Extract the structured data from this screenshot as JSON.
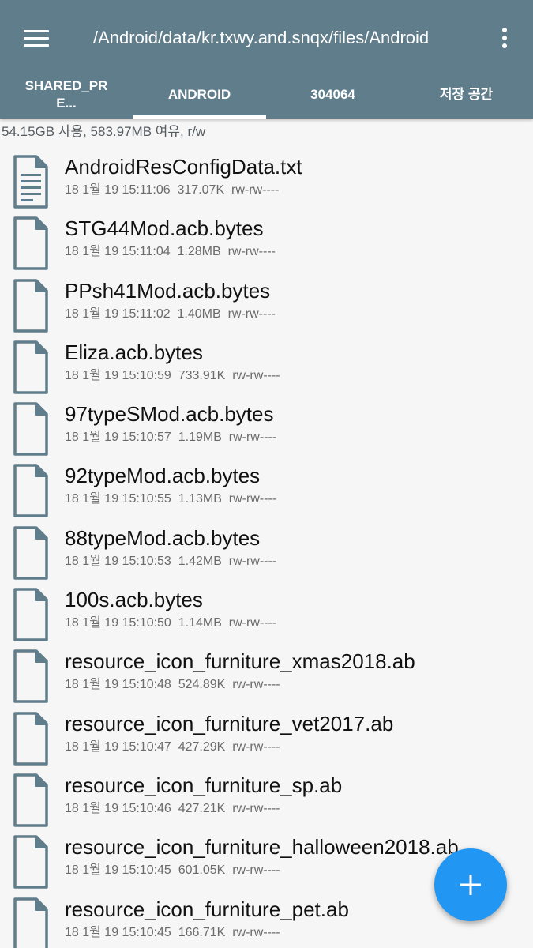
{
  "appbar": {
    "path": "/Android/data/kr.txwy.and.snqx/files/Android",
    "menu_icon": "hamburger-menu-icon",
    "more_icon": "vertical-dots-icon",
    "color": "#607d8b"
  },
  "tabs": [
    {
      "label": "SHARED_PRE..."
    },
    {
      "label": "ANDROID",
      "selected": true
    },
    {
      "label": "304064"
    },
    {
      "label": "저장 공간"
    }
  ],
  "storage": {
    "info": "54.15GB 사용, 583.97MB 여유, r/w"
  },
  "files": [
    {
      "name": "AndroidResConfigData.txt",
      "meta": "18 1월 19 15:11:06  317.07K  rw-rw----",
      "icon": "text-file-icon"
    },
    {
      "name": "STG44Mod.acb.bytes",
      "meta": "18 1월 19 15:11:04  1.28MB  rw-rw----",
      "icon": "file-icon"
    },
    {
      "name": "PPsh41Mod.acb.bytes",
      "meta": "18 1월 19 15:11:02  1.40MB  rw-rw----",
      "icon": "file-icon"
    },
    {
      "name": "Eliza.acb.bytes",
      "meta": "18 1월 19 15:10:59  733.91K  rw-rw----",
      "icon": "file-icon"
    },
    {
      "name": "97typeSMod.acb.bytes",
      "meta": "18 1월 19 15:10:57  1.19MB  rw-rw----",
      "icon": "file-icon"
    },
    {
      "name": "92typeMod.acb.bytes",
      "meta": "18 1월 19 15:10:55  1.13MB  rw-rw----",
      "icon": "file-icon"
    },
    {
      "name": "88typeMod.acb.bytes",
      "meta": "18 1월 19 15:10:53  1.42MB  rw-rw----",
      "icon": "file-icon"
    },
    {
      "name": "100s.acb.bytes",
      "meta": "18 1월 19 15:10:50  1.14MB  rw-rw----",
      "icon": "file-icon"
    },
    {
      "name": "resource_icon_furniture_xmas2018.ab",
      "meta": "18 1월 19 15:10:48  524.89K  rw-rw----",
      "icon": "file-icon"
    },
    {
      "name": "resource_icon_furniture_vet2017.ab",
      "meta": "18 1월 19 15:10:47  427.29K  rw-rw----",
      "icon": "file-icon"
    },
    {
      "name": "resource_icon_furniture_sp.ab",
      "meta": "18 1월 19 15:10:46  427.21K  rw-rw----",
      "icon": "file-icon"
    },
    {
      "name": "resource_icon_furniture_halloween2018.ab",
      "meta": "18 1월 19 15:10:45  601.05K  rw-rw----",
      "icon": "file-icon"
    },
    {
      "name": "resource_icon_furniture_pet.ab",
      "meta": "18 1월 19 15:10:45  166.71K  rw-rw----",
      "icon": "file-icon"
    }
  ],
  "fab": {
    "icon": "plus-icon",
    "color": "#2196f3"
  }
}
